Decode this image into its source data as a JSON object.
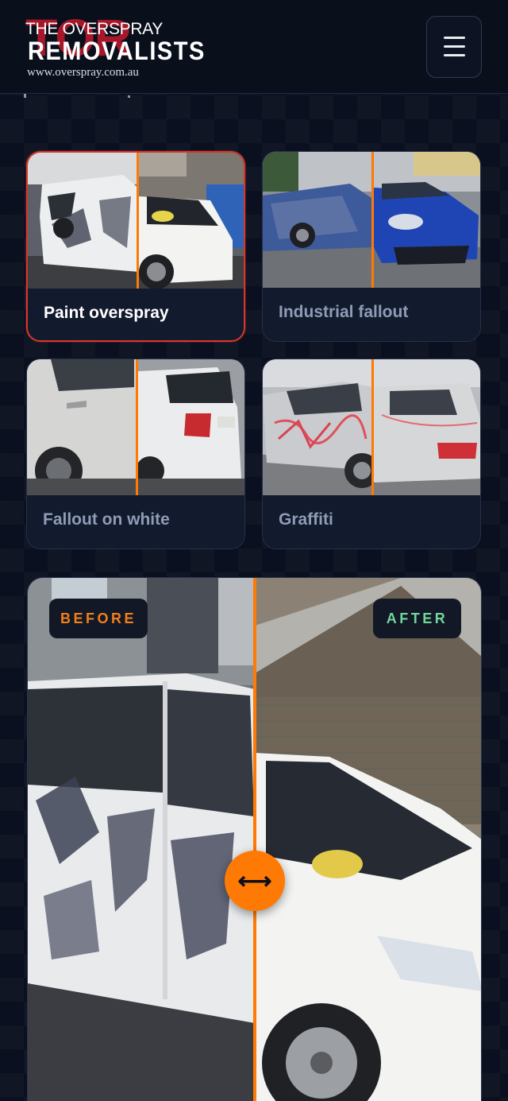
{
  "header": {
    "logo": {
      "background_text": "TOR",
      "line1": "THE OVERSPRAY",
      "line2": "REMOVALISTS",
      "line3": "www.overspray.com.au"
    },
    "menu_icon": "hamburger-menu-icon"
  },
  "gallery": {
    "cards": [
      {
        "label": "Paint overspray",
        "active": true
      },
      {
        "label": "Industrial fallout",
        "active": false
      },
      {
        "label": "Fallout on white",
        "active": false
      },
      {
        "label": "Graffiti",
        "active": false
      }
    ]
  },
  "comparison": {
    "before_label": "BEFORE",
    "after_label": "AFTER",
    "handle_icon": "left-right-arrow-icon",
    "handle_glyph": "⟷",
    "split_position": 0.5
  },
  "colors": {
    "accent": "#ff7a05",
    "active_border": "#d6362b",
    "before_text": "#f17f1a",
    "after_text": "#6fd79b",
    "background": "#0b1020"
  }
}
